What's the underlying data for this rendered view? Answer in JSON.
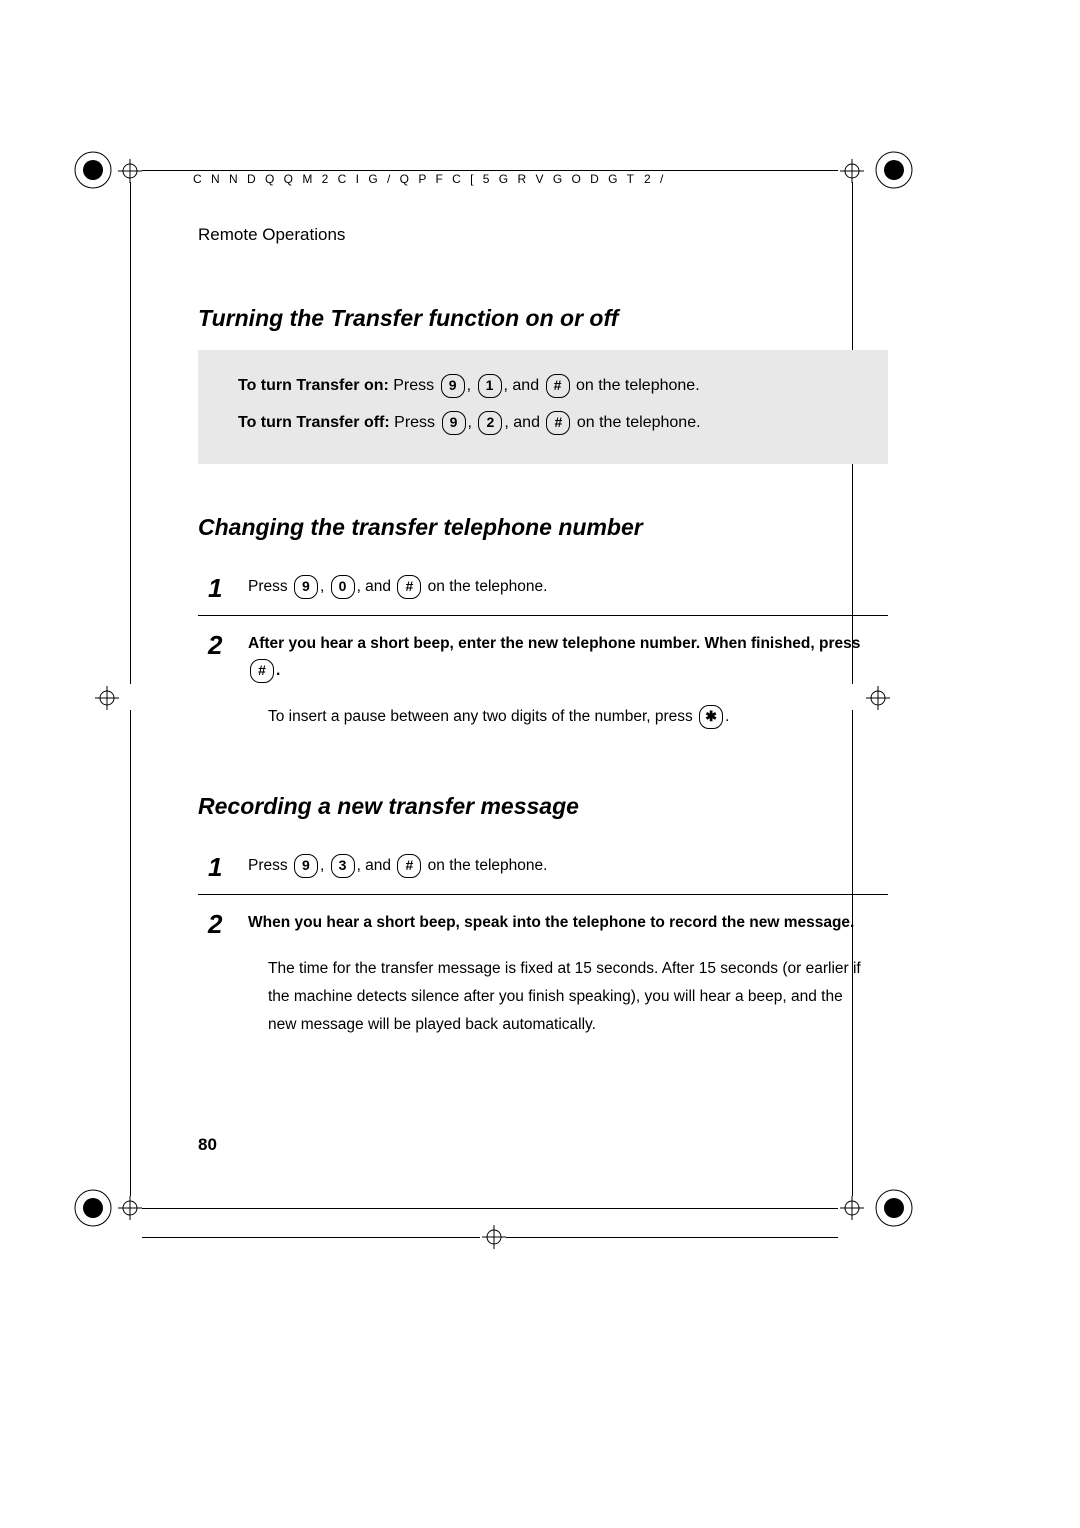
{
  "header": {
    "left": "C N N   D Q Q M    2 C I G        / Q P F C [    5 G R V G O D G T",
    "right": "2 /"
  },
  "breadcrumb": "Remote Operations",
  "section1": {
    "title": "Turning the Transfer function on or off",
    "on_label": "To turn Transfer on:",
    "on_press": " Press ",
    "on_k1": "9",
    "on_c1": ", ",
    "on_k2": "1",
    "on_c2": ", and ",
    "on_k3": "#",
    "on_tail": " on the telephone.",
    "off_label": "To turn Transfer off:",
    "off_press": " Press ",
    "off_k1": "9",
    "off_c1": ", ",
    "off_k2": "2",
    "off_c2": ", and ",
    "off_k3": "#",
    "off_tail": " on the telephone."
  },
  "section2": {
    "title": "Changing the transfer telephone number",
    "step1": {
      "num": "1",
      "press": "Press ",
      "k1": "9",
      "c1": ", ",
      "k2": "0",
      "c2": ", and ",
      "k3": "#",
      "tail": " on the telephone."
    },
    "step2": {
      "num": "2",
      "line1": "After you hear a short beep, enter the new telephone number. When finished, press ",
      "k1": "#",
      "period": ".",
      "note_pre": "To insert a pause between any two digits of the number, press ",
      "note_k": "✱",
      "note_post": "."
    }
  },
  "section3": {
    "title": "Recording a new transfer message",
    "step1": {
      "num": "1",
      "press": "Press ",
      "k1": "9",
      "c1": ", ",
      "k2": "3",
      "c2": ", and ",
      "k3": "#",
      "tail": " on the telephone."
    },
    "step2": {
      "num": "2",
      "bold": "When you hear a short beep, speak into the telephone to record the new message.",
      "note": "The time for the transfer message is fixed at 15 seconds. After 15 seconds (or earlier if the machine detects silence after you finish speaking), you will hear a beep, and the new message will be played back automatically."
    }
  },
  "page_number": "80"
}
